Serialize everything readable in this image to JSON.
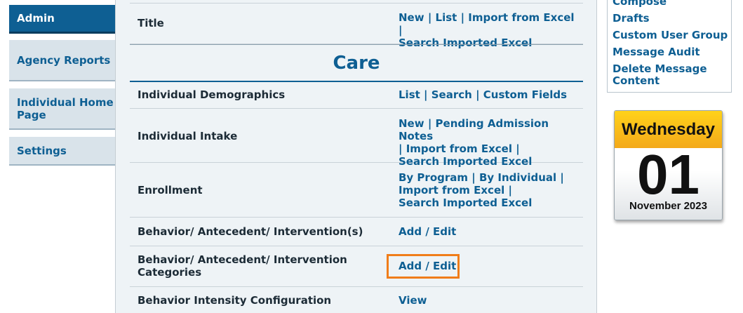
{
  "left_nav": {
    "items": [
      {
        "label": "Admin",
        "active": true
      },
      {
        "label": "Agency Reports",
        "active": false
      },
      {
        "label": "Individual Home Page",
        "active": false
      },
      {
        "label": "Settings",
        "active": false
      }
    ]
  },
  "main": {
    "top_row": {
      "label": "Title",
      "links": [
        "New",
        "List",
        "Import from Excel",
        "Search Imported Excel"
      ]
    },
    "section_title": "Care",
    "rows": [
      {
        "label": "Individual Demographics",
        "links": [
          "List",
          "Search",
          "Custom Fields"
        ]
      },
      {
        "label": "Individual Intake",
        "links": [
          "New",
          "Pending Admission Notes",
          "Import from Excel",
          "Search Imported Excel"
        ]
      },
      {
        "label": "Enrollment",
        "links": [
          "By Program",
          "By Individual",
          "Import from Excel",
          "Search Imported Excel"
        ]
      },
      {
        "label": "Behavior/ Antecedent/ Intervention(s)",
        "links": [
          "Add",
          "Edit"
        ]
      },
      {
        "label": "Behavior/ Antecedent/ Intervention Categories",
        "links": [
          "Add",
          "Edit"
        ]
      },
      {
        "label": "Behavior Intensity Configuration",
        "links": [
          "View"
        ]
      }
    ]
  },
  "message_menu": {
    "items": [
      "Compose",
      "Drafts",
      "Custom User Group",
      "Message Audit",
      "Delete Message Content"
    ]
  },
  "calendar": {
    "weekday": "Wednesday",
    "day": "01",
    "month_year": "November 2023"
  },
  "colors": {
    "accent": "#0e5f93",
    "highlight": "#f07d1a",
    "calendar_header": "#f8b81a"
  }
}
